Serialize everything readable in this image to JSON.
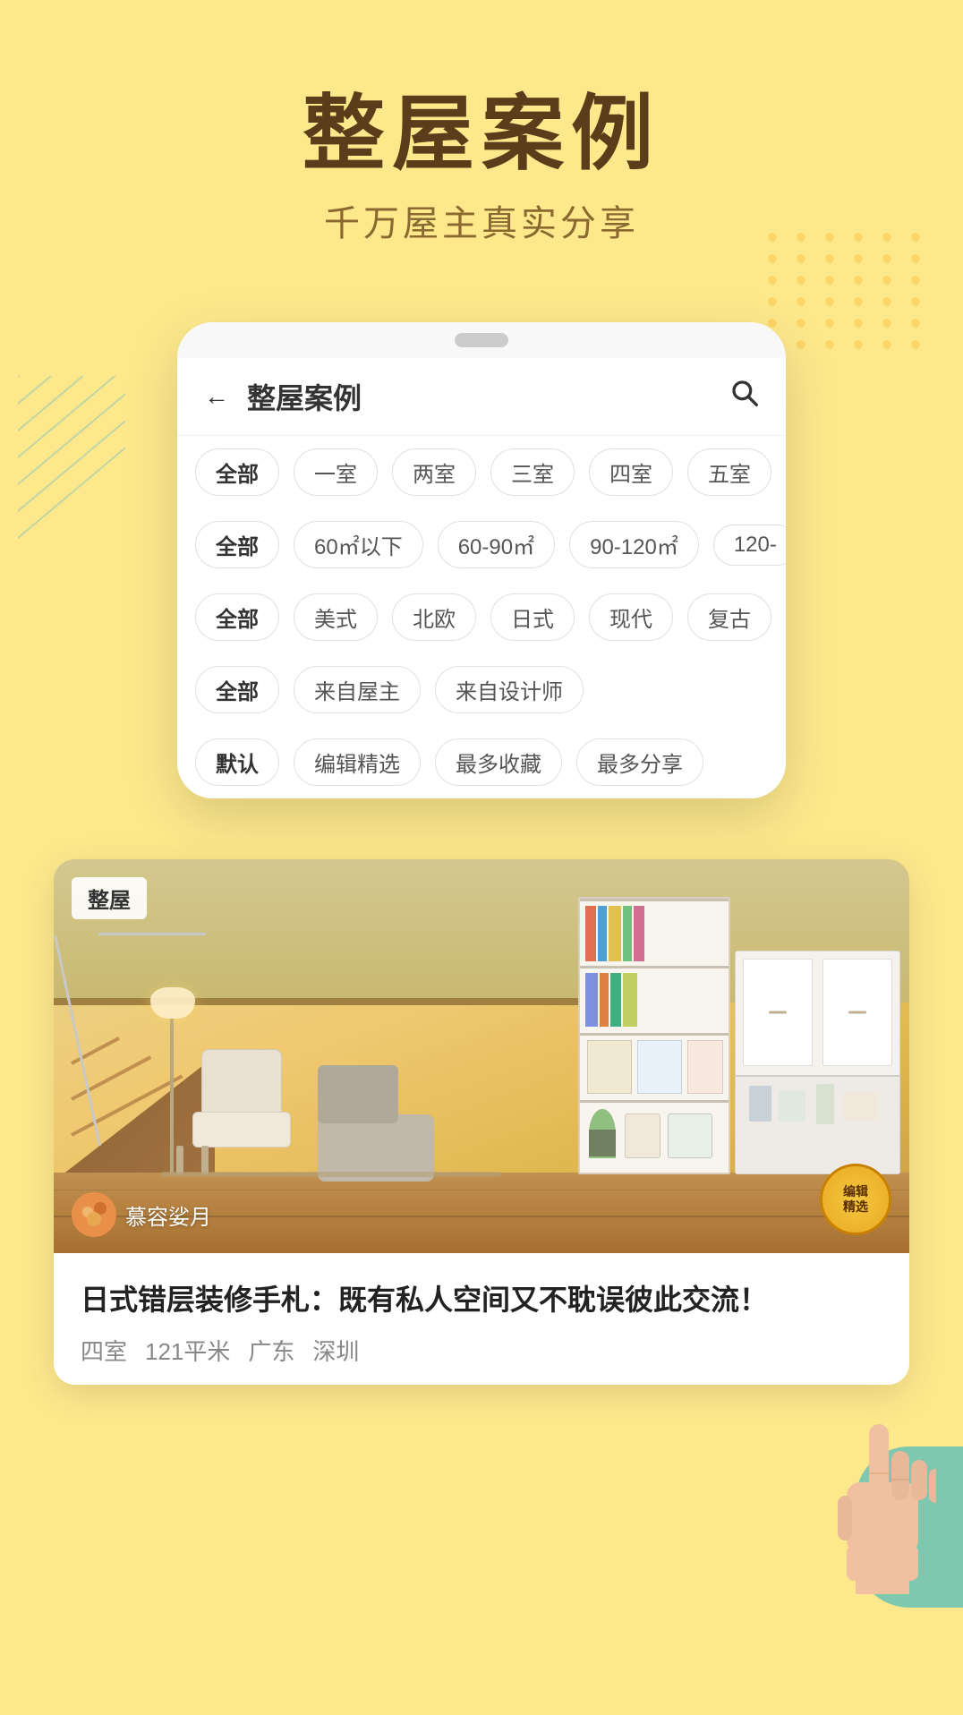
{
  "page": {
    "background_color": "#fde98c",
    "title": "整屋案例",
    "subtitle": "千万屋主真实分享"
  },
  "nav": {
    "back_icon": "←",
    "title": "整屋案例",
    "search_icon": "🔍"
  },
  "filters": {
    "row1": {
      "items": [
        "全部",
        "一室",
        "两室",
        "三室",
        "四室",
        "五室"
      ]
    },
    "row2": {
      "items": [
        "全部",
        "60㎡以下",
        "60-90㎡",
        "90-120㎡",
        "120-"
      ]
    },
    "row3": {
      "items": [
        "全部",
        "美式",
        "北欧",
        "日式",
        "现代",
        "复古"
      ]
    },
    "row4": {
      "items": [
        "全部",
        "来自屋主",
        "来自设计师"
      ]
    },
    "row5": {
      "items": [
        "默认",
        "编辑精选",
        "最多收藏",
        "最多分享"
      ]
    }
  },
  "card": {
    "badge_type": "整屋",
    "editor_badge_line1": "编辑",
    "editor_badge_line2": "精选",
    "user_name": "慕容娑月",
    "headline": "日式错层装修手札：既有私人空间又不耽误彼此交流！",
    "meta": {
      "rooms": "四室",
      "area": "121平米",
      "province": "广东",
      "city": "深圳"
    }
  },
  "decorations": {
    "dots_color": "rgba(255,200,80,0.6)",
    "lines_color": "rgba(100,180,200,0.4)",
    "teal_shape_color": "#7ec8b0",
    "yellow_shape_color": "#f5c842"
  }
}
